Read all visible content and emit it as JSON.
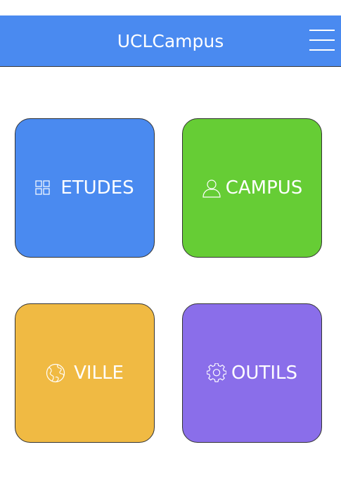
{
  "header": {
    "title": "UCLCampus",
    "menu_icon": "hamburger-menu-icon"
  },
  "tiles": [
    {
      "label": "ETUDES",
      "icon": "grid-icon",
      "color": "#4a8af0"
    },
    {
      "label": "CAMPUS",
      "icon": "user-icon",
      "color": "#66cd35"
    },
    {
      "label": "VILLE",
      "icon": "globe-icon",
      "color": "#f0ba43"
    },
    {
      "label": "OUTILS",
      "icon": "gear-icon",
      "color": "#8a6eea"
    }
  ]
}
